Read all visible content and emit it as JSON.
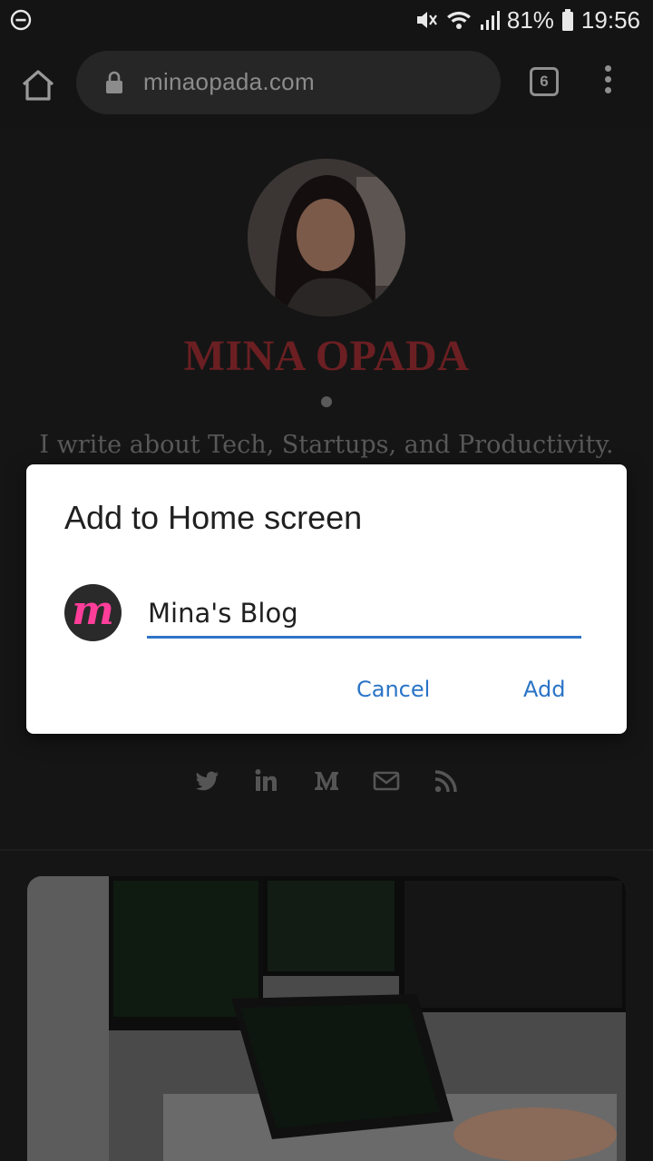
{
  "status_bar": {
    "battery": "81%",
    "time": "19:56"
  },
  "toolbar": {
    "url": "minaopada.com",
    "tab_count": "6"
  },
  "page": {
    "site_title": "MINA OPADA",
    "tagline": "I write about Tech, Startups, and Productivity.",
    "social_icons": [
      "twitter-icon",
      "linkedin-icon",
      "medium-icon",
      "email-icon",
      "rss-icon"
    ]
  },
  "dialog": {
    "title": "Add to Home screen",
    "icon_letter": "m",
    "name_value": "Mina's Blog",
    "cancel_label": "Cancel",
    "add_label": "Add",
    "accent_color": "#2f73c8"
  }
}
